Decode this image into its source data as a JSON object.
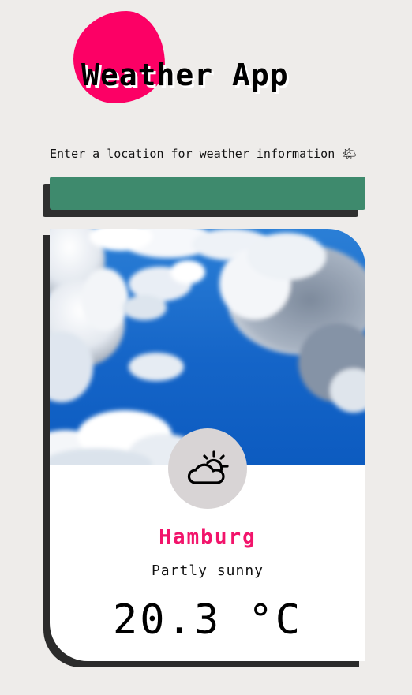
{
  "header": {
    "title": "Weather App"
  },
  "search": {
    "prompt": "Enter a location for weather information 🌤",
    "value": "",
    "placeholder": ""
  },
  "weather_card": {
    "image": "sky-with-clouds",
    "icon": "partly-sunny-icon",
    "city": "Hamburg",
    "description": "Partly sunny",
    "temperature": "20.3 °C"
  },
  "colors": {
    "background": "#eeecea",
    "accent_blob": "#fc0065",
    "search_bar": "#3e8a6d",
    "city_text": "#f2146b",
    "icon_circle": "#d8d4d5"
  }
}
